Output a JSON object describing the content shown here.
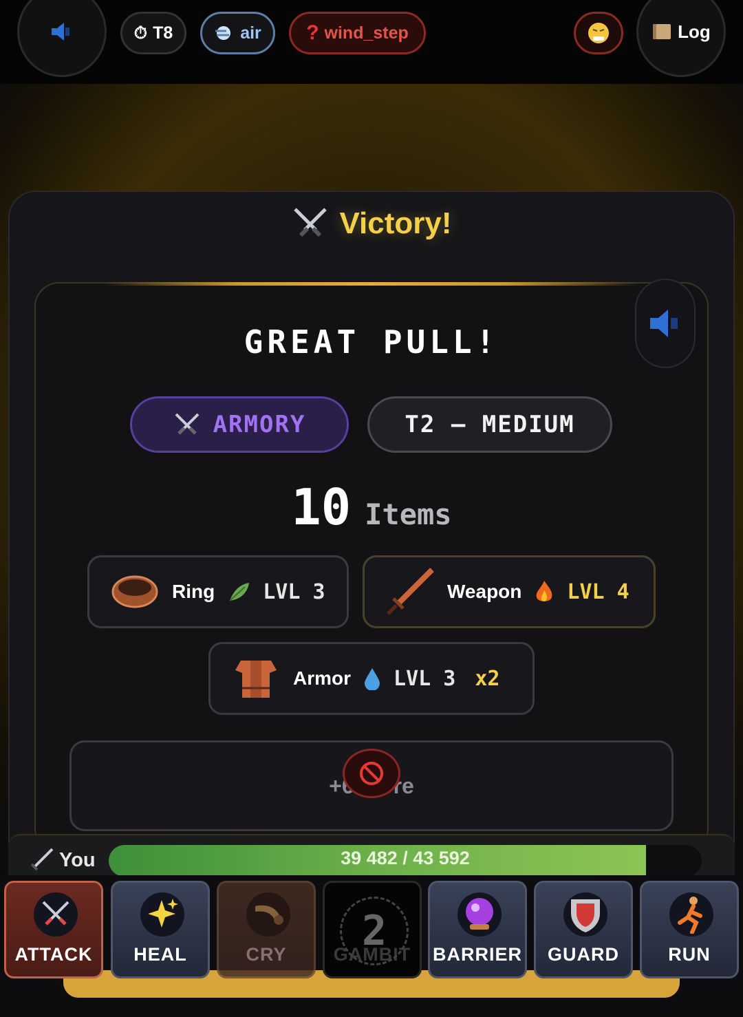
{
  "top": {
    "turn": "T8",
    "element": "air",
    "unknown": "wind_step",
    "log": "Log"
  },
  "victory": "Victory!",
  "result": {
    "headline": "GREAT PULL!",
    "source": "ARMORY",
    "tier": "T2 — MEDIUM",
    "count": "10",
    "count_label": "Items",
    "items": [
      {
        "name": "Ring",
        "level": "LVL 3",
        "element_icon": "leaf-icon"
      },
      {
        "name": "Weapon",
        "level": "LVL 4",
        "element_icon": "fire-icon"
      },
      {
        "name": "Armor",
        "level": "LVL 3",
        "element_icon": "water-drop-icon",
        "mult": "x2"
      }
    ],
    "more": "+6 more"
  },
  "player": {
    "name": "You",
    "hp_text": "39 482 / 43 592",
    "hp_fraction": 0.906
  },
  "actions": [
    {
      "label": "ATTACK"
    },
    {
      "label": "HEAL"
    },
    {
      "label": "CRY"
    },
    {
      "label": "GAMBIT",
      "count": "2"
    },
    {
      "label": "BARRIER"
    },
    {
      "label": "GUARD"
    },
    {
      "label": "RUN"
    }
  ]
}
